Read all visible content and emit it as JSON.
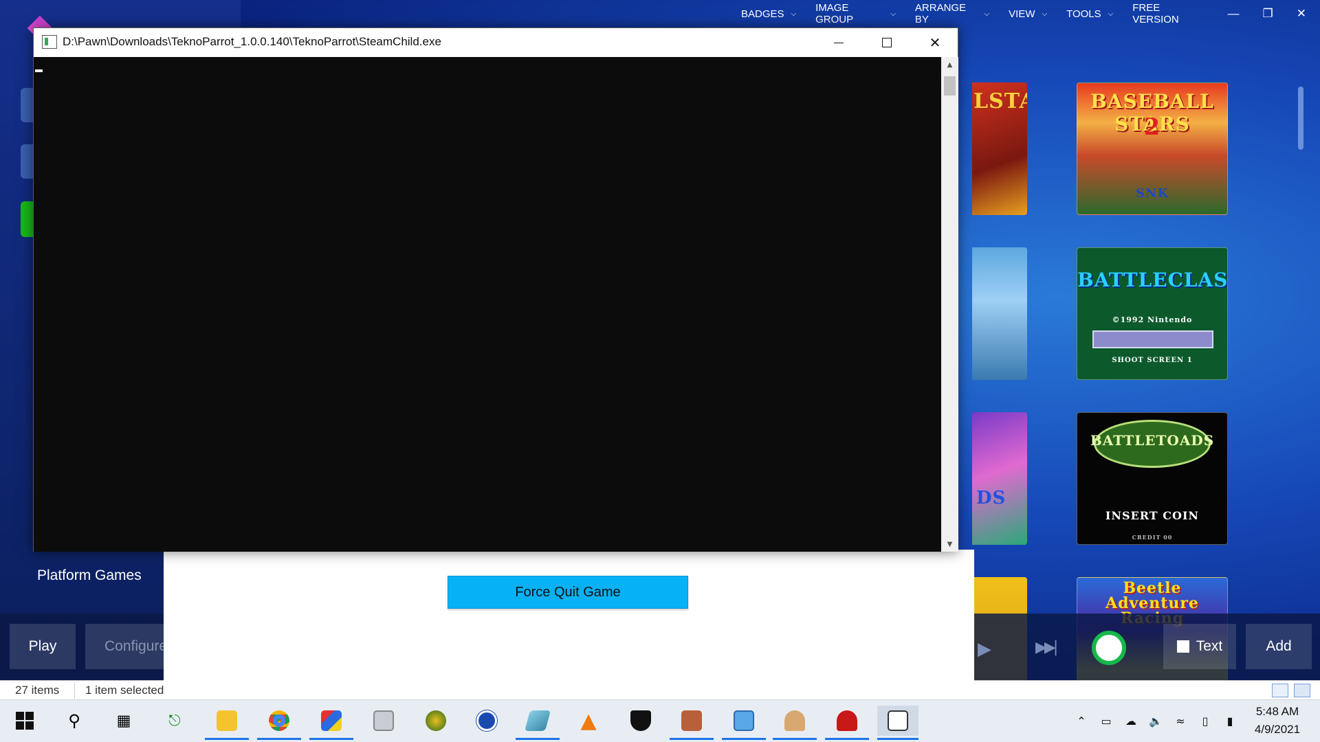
{
  "launchbox": {
    "menu": {
      "badges": "BADGES",
      "image_group": "IMAGE GROUP",
      "arrange_by": "ARRANGE BY",
      "view": "VIEW",
      "tools": "TOOLS",
      "free_version": "FREE VERSION"
    },
    "platform_label": "Platform Games",
    "buttons": {
      "play": "Play",
      "configure": "Configure",
      "text": "Text",
      "add": "Add"
    },
    "status": {
      "items_count": "27 items",
      "selected": "1 item selected"
    },
    "covers": [
      {
        "title": "BASEBALL STARS",
        "badge": "2",
        "footer": "SNK"
      },
      {
        "title": "BATTLECLASH",
        "sub": "©1992 Nintendo",
        "footer": "SHOOT SCREEN 1"
      },
      {
        "title": "BATTLETOADS",
        "sub": "INSERT COIN",
        "footer": "CREDIT 00"
      },
      {
        "title": "Beetle Adventure Racing"
      }
    ],
    "partial_covers": [
      {
        "title": "LSTARS"
      },
      {
        "title": ""
      },
      {
        "title": "DS"
      },
      {
        "title": ""
      }
    ]
  },
  "console_window": {
    "title": "D:\\Pawn\\Downloads\\TeknoParrot_1.0.0.140\\TeknoParrot\\SteamChild.exe"
  },
  "dialog": {
    "force_quit": "Force Quit Game"
  },
  "taskbar": {
    "apps": [
      "start-icon",
      "search-icon",
      "task-view-icon",
      "usb-icon",
      "file-explorer-icon",
      "chrome-icon",
      "rubiks-cube-icon",
      "monitor-app-icon",
      "world-app-icon",
      "power-app-icon",
      "eraser-app-icon",
      "vlc-icon",
      "shield-app-icon",
      "brick-app-icon",
      "control-panel-icon",
      "people-app-icon",
      "ninja-app-icon",
      "console-app-icon"
    ],
    "clock": {
      "time": "5:48 AM",
      "date": "4/9/2021"
    }
  },
  "colors": {
    "accent_blue": "#07b1f5",
    "desktop_blue": "#1648b8",
    "taskbar_underline": "#1a73e8"
  }
}
